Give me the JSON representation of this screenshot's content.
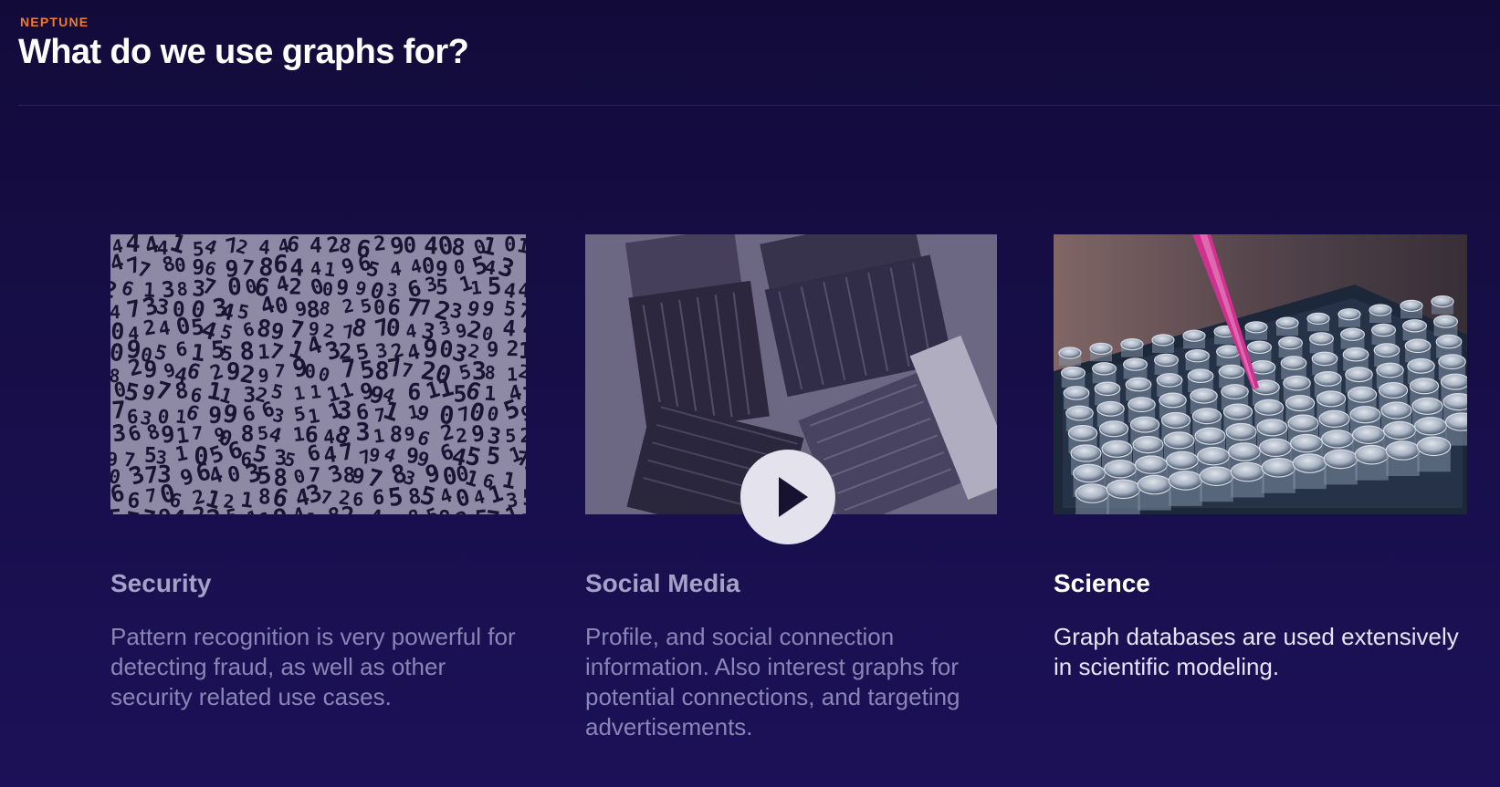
{
  "header": {
    "eyebrow": "NEPTUNE",
    "title": "What do we use graphs for?"
  },
  "cards": [
    {
      "title": "Security",
      "description": "Pattern recognition is very powerful for detecting fraud, as well as other security related use cases.",
      "image_icon": "number-pattern-image"
    },
    {
      "title": "Social Media",
      "description": "Profile, and social connection information. Also interest graphs for potential connections, and targeting advertisements.",
      "image_icon": "paint-brushes-image"
    },
    {
      "title": "Science",
      "description": "Graph databases are used extensively in scientific modeling.",
      "image_icon": "test-tubes-pipette-image"
    }
  ],
  "video": {
    "play_icon": "play-icon"
  },
  "colors": {
    "accent": "#f07a2c",
    "background": "#170e48",
    "pipette": "#e0359a"
  }
}
